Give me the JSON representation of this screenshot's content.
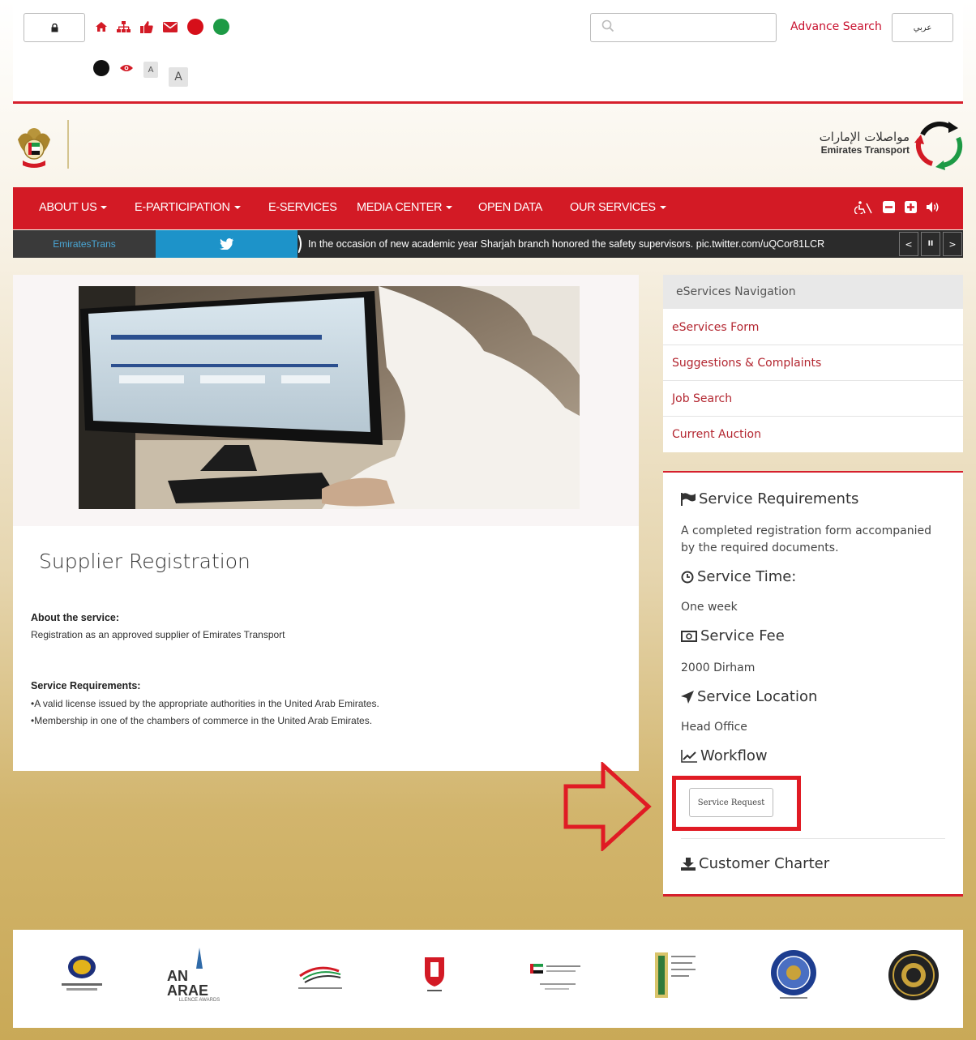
{
  "utility_bar": {
    "lock_icon": "lock-icon",
    "icons": [
      "home-icon",
      "sitemap-icon",
      "thumbs-up-icon",
      "envelope-icon",
      "red-dot",
      "green-dot"
    ],
    "contrast_icons": [
      "black-dot",
      "eye-icon"
    ],
    "font_small": "A",
    "font_large": "A",
    "search": {
      "placeholder": "",
      "icon": "search-icon"
    },
    "advance_search": "Advance Search",
    "language_button": "عربي"
  },
  "header": {
    "brand_ar": "مواصلات الإمارات",
    "brand_en": "Emirates Transport"
  },
  "nav": {
    "items": [
      {
        "label": "ABOUT US",
        "dropdown": true
      },
      {
        "label": "E-PARTICIPATION",
        "dropdown": true
      },
      {
        "label": "E-SERVICES",
        "dropdown": false
      },
      {
        "label": "MEDIA CENTER",
        "dropdown": true
      },
      {
        "label": "OPEN DATA",
        "dropdown": false
      },
      {
        "label": "OUR SERVICES",
        "dropdown": true
      }
    ],
    "tools": [
      "accessibility-icon",
      "zoom-out-icon",
      "zoom-in-icon",
      "volume-icon"
    ]
  },
  "ticker": {
    "handle": "EmiratesTrans",
    "text": "In the occasion of new academic year Sharjah branch honored the safety supervisors. pic.twitter.com/uQCor81LCR",
    "controls": [
      "<",
      "II",
      ">"
    ]
  },
  "main": {
    "title": "Supplier Registration",
    "about_heading": "About the service:",
    "about_text": "Registration as an approved supplier of Emirates Transport",
    "req_heading": "Service Requirements:",
    "req_items": [
      "•A valid license issued by the appropriate authorities in the United Arab Emirates.",
      "•Membership in one of the chambers of commerce in the United Arab Emirates."
    ]
  },
  "sidebar": {
    "nav_title": "eServices Navigation",
    "links": [
      "eServices Form",
      "Suggestions & Complaints",
      "Job Search",
      "Current Auction"
    ]
  },
  "requirements_panel": {
    "req_title": "Service Requirements",
    "req_text": "A completed registration form accompanied by the required documents.",
    "time_title": "Service Time:",
    "time_value": "One week",
    "fee_title": "Service Fee",
    "fee_value": "2000 Dirham",
    "location_title": "Service Location",
    "location_value": "Head Office",
    "workflow_title": "Workflow",
    "service_request_button": "Service Request",
    "charter_title": "Customer Charter"
  },
  "footer": {
    "partners": [
      "partner-logo-1",
      "partner-logo-arab-excellence",
      "partner-logo-energy-award",
      "partner-logo-abu-dhabi",
      "partner-logo-uae-award",
      "partner-logo-quality",
      "partner-logo-guinness",
      "partner-logo-seal"
    ],
    "arab_logo_text": "AN ARAE",
    "arab_logo_sub": "LLENCE AWARDS"
  },
  "colors": {
    "brand_red": "#d31a25",
    "link_red": "#b32630",
    "twitter_blue": "#1d93c9"
  }
}
